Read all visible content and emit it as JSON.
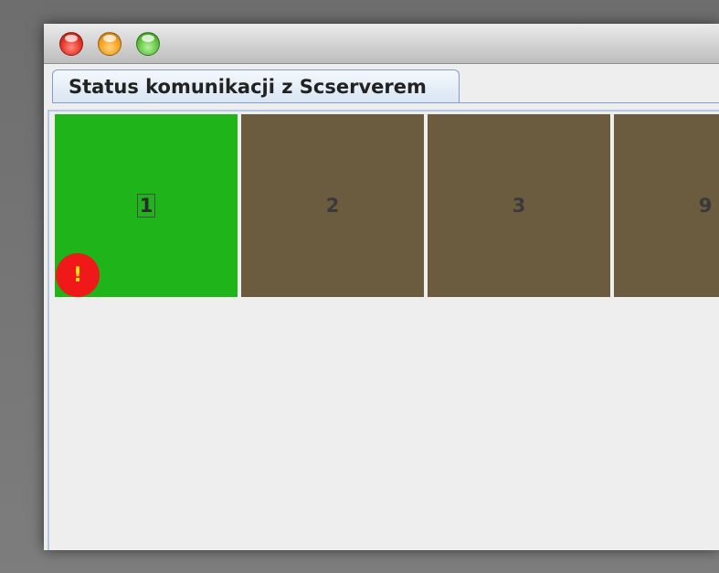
{
  "window": {
    "controls": [
      {
        "name": "close-button",
        "color": "#e63226"
      },
      {
        "name": "minimize-button",
        "color": "#f4a020"
      },
      {
        "name": "maximize-button",
        "color": "#5fc43e"
      }
    ]
  },
  "tabs": [
    {
      "label": "Status komunikacji z Scserverem",
      "selected": true
    }
  ],
  "tiles": [
    {
      "label": "1",
      "status_color": "#1fb41a",
      "focused": true,
      "alert": {
        "icon": "warning-icon",
        "text": "!"
      }
    },
    {
      "label": "2",
      "status_color": "#6b5c40"
    },
    {
      "label": "3",
      "status_color": "#6b5c40"
    },
    {
      "label": "9",
      "status_color": "#6b5c40"
    }
  ]
}
